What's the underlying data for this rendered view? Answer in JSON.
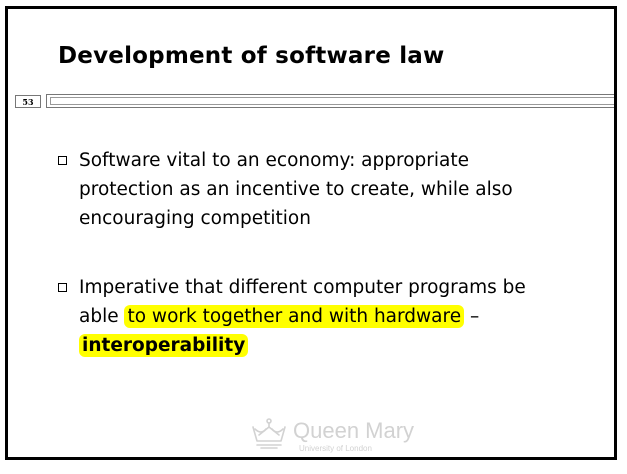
{
  "slide": {
    "title": "Development of software law",
    "page_number": "53",
    "bullets": [
      {
        "text": "Software vital to an economy: appropriate protection as an incentive to create, while also encouraging competition"
      },
      {
        "text_before": "Imperative that different computer programs be able ",
        "highlight_1": "to work together and with hardware",
        "text_middle": " –",
        "highlight_2": "interoperability"
      }
    ],
    "colors": {
      "highlight": "#ffff00",
      "logo_grey": "#d2d2d2"
    },
    "logo": {
      "name": "Queen Mary",
      "subtitle": "University of London",
      "icon": "crown-icon"
    }
  }
}
